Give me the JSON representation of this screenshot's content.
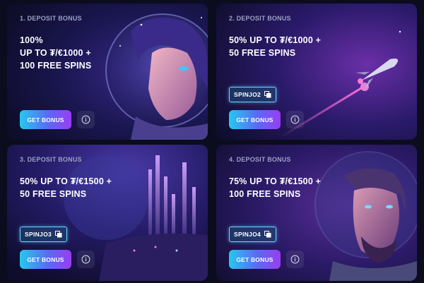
{
  "offers": [
    {
      "step": "1. DEPOSIT BONUS",
      "title_lines": [
        "100%",
        "UP TO ₮/€1000 +",
        "100 FREE SPINS"
      ],
      "promo_code": null,
      "cta_label": "GET BONUS",
      "image": "astronaut-woman-helmet-illustration"
    },
    {
      "step": "2. DEPOSIT BONUS",
      "title_lines": [
        "50% UP TO ₮/€1000 +",
        "50 FREE SPINS"
      ],
      "promo_code": "SPINJO2",
      "cta_label": "GET BONUS",
      "image": "rocket-in-space-illustration"
    },
    {
      "step": "3. DEPOSIT BONUS",
      "title_lines": [
        "50% UP TO ₮/€1500 +",
        "50 FREE SPINS"
      ],
      "promo_code": "SPINJO3",
      "cta_label": "GET BONUS",
      "image": "futuristic-city-planet-illustration"
    },
    {
      "step": "4. DEPOSIT BONUS",
      "title_lines": [
        "75% UP TO ₮/€1500 +",
        "100 FREE SPINS"
      ],
      "promo_code": "SPINJO4",
      "cta_label": "GET BONUS",
      "image": "astronaut-man-helmet-illustration"
    }
  ],
  "icons": {
    "copy": "copy-icon",
    "info": "info-icon"
  },
  "colors": {
    "page_bg": "#0b0c1e",
    "cta_gradient_start": "#26c8f0",
    "cta_gradient_end": "#9a3cf2",
    "promo_border": "#6fd6ff"
  }
}
